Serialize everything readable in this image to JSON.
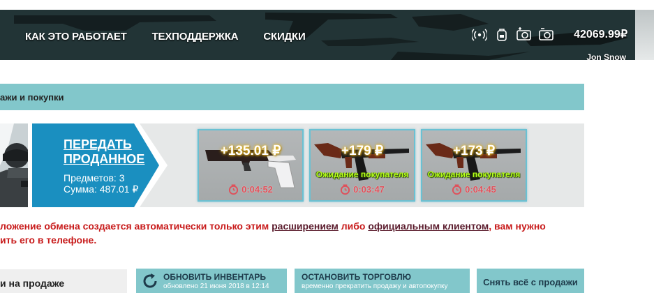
{
  "header": {
    "nav": [
      "КАК ЭТО РАБОТАЕТ",
      "ТЕХПОДДЕРЖКА",
      "СКИДКИ"
    ],
    "icons": [
      "broadcast-icon",
      "backpack-icon",
      "add-camera-icon",
      "remove-camera-icon"
    ],
    "balance": "42069.99₽",
    "username": "Jon Snow"
  },
  "section": {
    "title": "ажи и покупки"
  },
  "transfer": {
    "link_label": "ПЕРЕДАТЬ ПРОДАННОЕ",
    "items_count": "Предметов: 3",
    "total": "Сумма: 487.01 ₽"
  },
  "items": [
    {
      "price": "+135.01 ₽",
      "status": "",
      "timer": "0:04:52",
      "weapon": "pistol"
    },
    {
      "price": "+179 ₽",
      "status": "Ожидание покупателя",
      "timer": "0:03:47",
      "weapon": "rifle"
    },
    {
      "price": "+173 ₽",
      "status": "Ожидание покупателя",
      "timer": "0:04:45",
      "weapon": "rifle"
    }
  ],
  "warning": {
    "part1": "ложение обмена создается автоматически только этим ",
    "link1": "расширением",
    "part2": " либо ",
    "link2": "официальным клиентом",
    "part3": ", вам нужно",
    "line2": "ить его в телефоне."
  },
  "bottom": {
    "on_sale_label": "и на продаже",
    "refresh_title": "ОБНОВИТЬ ИНВЕНТАРЬ",
    "refresh_sub": "обновлено 21 июня 2018 в 12:14",
    "stop_title": "ОСТАНОВИТЬ ТОРГОВЛЮ",
    "stop_sub": "временно прекратить продажу и автопокупку",
    "remove_all": "Снять всё с продажи"
  },
  "colors": {
    "accent_teal": "#82c7cb",
    "arrow_blue": "#1a8fc0",
    "warning_red": "#c81c1c",
    "status_green": "#b5ff1a",
    "timer_red": "#e0505a"
  }
}
